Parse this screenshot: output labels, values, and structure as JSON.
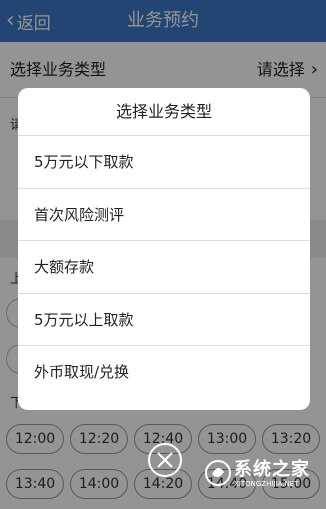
{
  "header": {
    "back_label": "返回",
    "title": "业务预约"
  },
  "form": {
    "type_label": "选择业务类型",
    "type_value": "请选择",
    "peek_label_1": "请",
    "peek_label_2": "上",
    "peek_label_3": "下"
  },
  "time_slots": {
    "row1": [
      "12:00",
      "12:20",
      "12:40",
      "13:00",
      "13:20"
    ],
    "row2": [
      "13:40",
      "14:00",
      "14:20",
      "14:40",
      "15:00"
    ]
  },
  "dialog": {
    "title": "选择业务类型",
    "options": [
      "5万元以下取款",
      "首次风险测评",
      "大额存款",
      "5万元以上取款",
      "外币取现/兑换"
    ]
  },
  "watermark": {
    "text": "系统之家",
    "sub": "XITONGZHIJIA.NET"
  },
  "colors": {
    "header_bg": "#3c78c8",
    "overlay": "rgba(0,0,0,0.42)"
  }
}
